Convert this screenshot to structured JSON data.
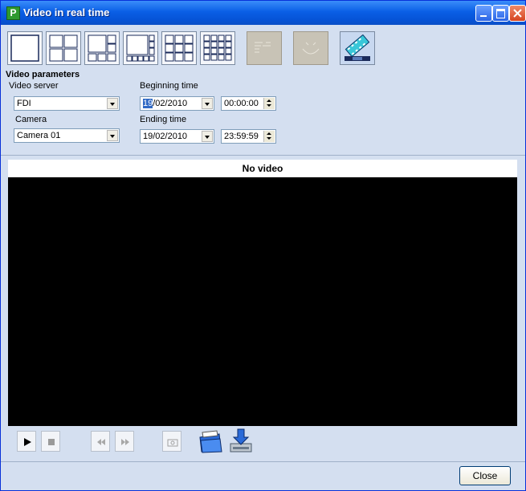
{
  "window": {
    "title": "Video in real time",
    "app_icon_letter": "P"
  },
  "toolbar": {
    "layout_buttons": [
      "layout-1x1-icon",
      "layout-2x2-icon",
      "layout-1plus5-icon",
      "layout-1plus7-icon",
      "layout-3x3-icon",
      "layout-4x4-icon"
    ],
    "extra_buttons": [
      "sequence-icon",
      "camera-icon",
      "film-icon"
    ]
  },
  "params": {
    "section_title": "Video parameters",
    "video_server_label": "Video server",
    "video_server_value": "FDI",
    "camera_label": "Camera",
    "camera_value": "Camera 01",
    "beginning_label": "Beginning time",
    "beginning_date_day": "19",
    "beginning_date_rest": "/02/2010",
    "beginning_time": "00:00:00",
    "ending_label": "Ending time",
    "ending_date": "19/02/2010",
    "ending_time": "23:59:59"
  },
  "video": {
    "status": "No video"
  },
  "controls": [
    "play-icon",
    "stop-icon",
    "rewind-icon",
    "fast-forward-icon",
    "snapshot-icon",
    "open-folder-icon",
    "download-icon"
  ],
  "footer": {
    "close_label": "Close"
  },
  "colors": {
    "titlebar": "#0a5fe6",
    "panel": "#d4dff0",
    "video_bg": "#000000",
    "selection": "#316ac5"
  }
}
